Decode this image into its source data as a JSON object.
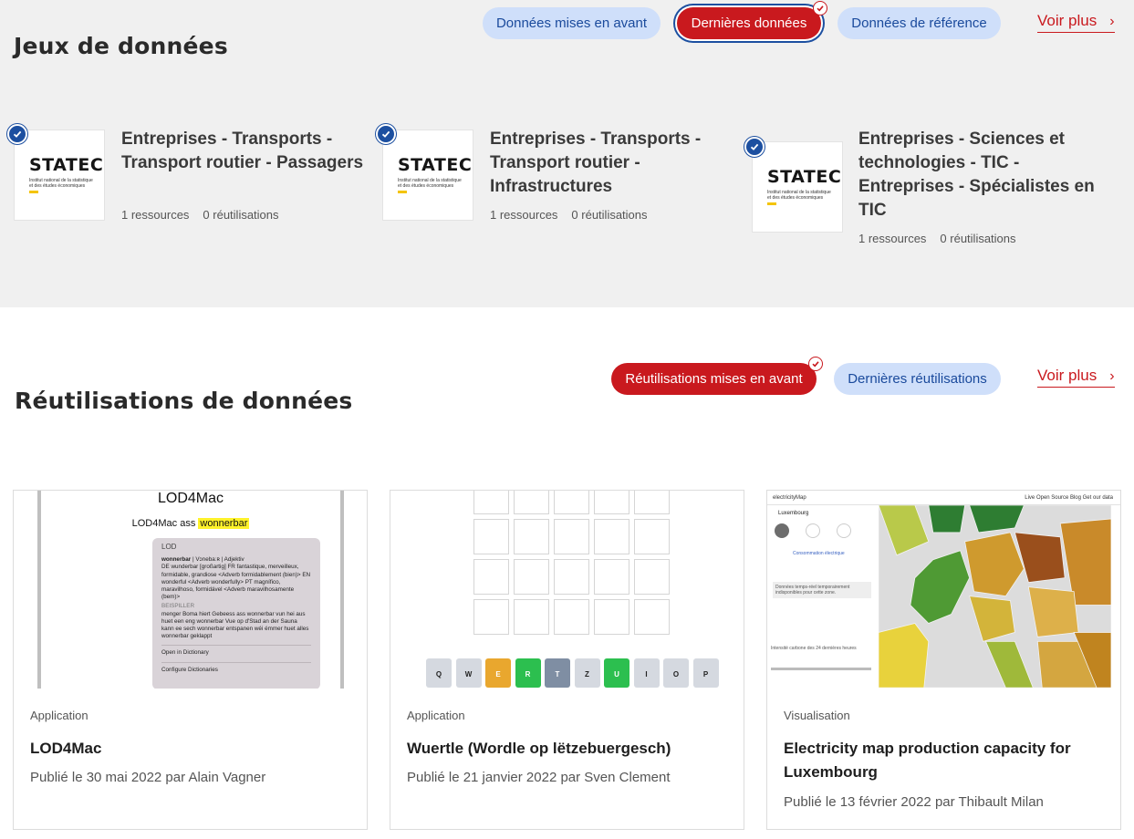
{
  "datasets_section": {
    "title": "Jeux de données",
    "tabs": [
      {
        "label": "Données mises en avant",
        "selected": false
      },
      {
        "label": "Dernières données",
        "selected": true
      },
      {
        "label": "Données de référence",
        "selected": false
      }
    ],
    "see_more": "Voir plus",
    "cards": [
      {
        "org_logo": "STATEC",
        "org_subtitle": "Institut national de la statistique et des études économiques",
        "title": "Entreprises - Transports - Transport routier - Passagers",
        "resources": "1 ressources",
        "reuses": "0 réutilisations",
        "certified": true
      },
      {
        "org_logo": "STATEC",
        "org_subtitle": "Institut national de la statistique et des études économiques",
        "title": "Entreprises - Transports - Transport routier - Infrastructures",
        "resources": "1 ressources",
        "reuses": "0 réutilisations",
        "certified": true
      },
      {
        "org_logo": "STATEC",
        "org_subtitle": "Institut national de la statistique et des études économiques",
        "title": "Entreprises - Sciences et technologies - TIC - Entreprises - Spécialistes en TIC",
        "resources": "1 ressources",
        "reuses": "0 réutilisations",
        "certified": true
      }
    ]
  },
  "reuses_section": {
    "title": "Réutilisations de données",
    "tabs": [
      {
        "label": "Réutilisations mises en avant",
        "selected": true
      },
      {
        "label": "Dernières réutilisations",
        "selected": false
      }
    ],
    "see_more": "Voir plus",
    "cards": [
      {
        "type": "Application",
        "title": "LOD4Mac",
        "published": "Publié le 30 mai 2022 par Alain Vagner"
      },
      {
        "type": "Application",
        "title": "Wuertle (Wordle op lëtzebuergesch)",
        "published": "Publié le 21 janvier 2022 par Sven Clement"
      },
      {
        "type": "Visualisation",
        "title": "Electricity map production capacity for Luxembourg",
        "published": "Publié le 13 février 2022 par Thibault Milan"
      }
    ]
  },
  "thumbnails": {
    "lod4mac": {
      "app_title": "LOD4Mac",
      "sentence_prefix": "LOD4Mac ass",
      "sentence_highlight": "wonnerbar",
      "popup_header": "LOD",
      "entry_word": "wonnerbar",
      "entry_pron": "| Vɔnebaːʀ |",
      "entry_pos": "Adjektiv",
      "translations": "DE wunderbar [großartig]  FR fantastique, merveilleux, formidable, grandiose <Adverb formidablement (bien)>  EN wonderful <Adverb wonderfully>  PT magnífico, maravilhoso, formidável <Adverb maravilhosamente (bem)>",
      "examples_label": "BEISPILLER",
      "examples": "menger Boma hiert Gebeess ass wonnerbar vun hei aus huet een eng wonnerbar Vue op d'Stad an der Sauna kann ee sech wonnerbar entspanen wéi émmer huet alles wonnerbar geklappt",
      "menu_open": "Open in Dictionary",
      "menu_configure": "Configure Dictionaries"
    },
    "wuertle": {
      "keys": [
        {
          "letter": "Q",
          "state": "default"
        },
        {
          "letter": "W",
          "state": "default"
        },
        {
          "letter": "E",
          "state": "present"
        },
        {
          "letter": "R",
          "state": "correct"
        },
        {
          "letter": "T",
          "state": "absent"
        },
        {
          "letter": "Z",
          "state": "default"
        },
        {
          "letter": "U",
          "state": "correct"
        },
        {
          "letter": "I",
          "state": "default"
        },
        {
          "letter": "O",
          "state": "default"
        },
        {
          "letter": "P",
          "state": "default"
        }
      ]
    },
    "electricity_map": {
      "brand": "electricityMap",
      "nav": "Live   Open Source   Blog   Get our data",
      "zone": "Luxembourg",
      "panel_label": "Consommation électrique",
      "panel_note": "Données temps-réel temporairement indisponibles pour cette zone.",
      "history_label": "Intensité carbone des 24 dernières heures"
    }
  },
  "colors": {
    "accent_red": "#c9191e",
    "pill_blue_bg": "#cfdffa",
    "pill_blue_text": "#1a4a9c",
    "certified_blue": "#1c4fa0",
    "datasets_bg": "#f0f0f0"
  }
}
